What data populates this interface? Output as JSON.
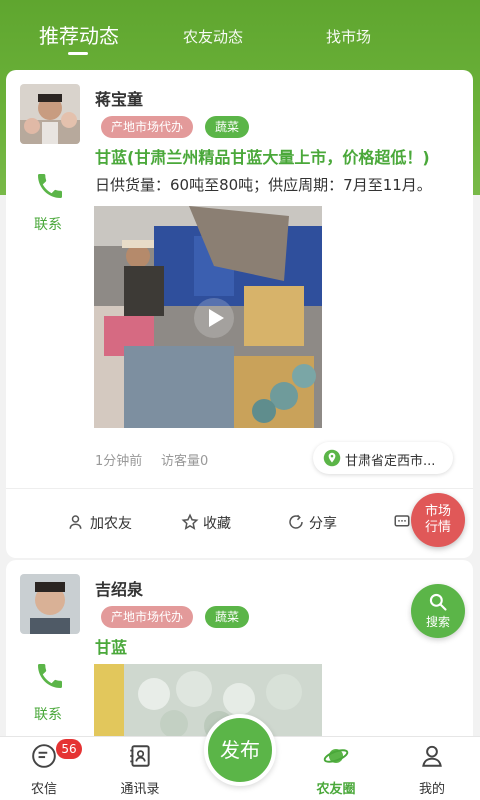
{
  "tabs": [
    {
      "label": "推荐动态",
      "active": true
    },
    {
      "label": "农友动态",
      "active": false
    },
    {
      "label": "找市场",
      "active": false
    }
  ],
  "posts": [
    {
      "name": "蒋宝童",
      "tags": [
        "产地市场代办",
        "蔬菜"
      ],
      "headline": "甘蓝(甘肃兰州精品甘蓝大量上市，价格超低！)",
      "supply": "日供货量：60吨至80吨；供应周期：7月至11月。",
      "contact_label": "联系",
      "time": "1分钟前",
      "views": "访客量0",
      "location": "甘肃省定西市..."
    },
    {
      "name": "吉绍泉",
      "tags": [
        "产地市场代办",
        "蔬菜"
      ],
      "headline": "甘蓝",
      "contact_label": "联系"
    }
  ],
  "actions": {
    "add_friend": "加农友",
    "favorite": "收藏",
    "share": "分享"
  },
  "floating": {
    "market_line1": "市场",
    "market_line2": "行情",
    "search": "搜索"
  },
  "bottom_nav": {
    "messages": "农信",
    "messages_badge": "56",
    "contacts": "通讯录",
    "publish": "发布",
    "circle": "农友圈",
    "mine": "我的"
  },
  "colors": {
    "brand_green": "#5bb548",
    "header_green": "#6cb23a",
    "tag_pink": "#e39a9a",
    "market_red": "#e05858",
    "badge_red": "#e53333"
  }
}
